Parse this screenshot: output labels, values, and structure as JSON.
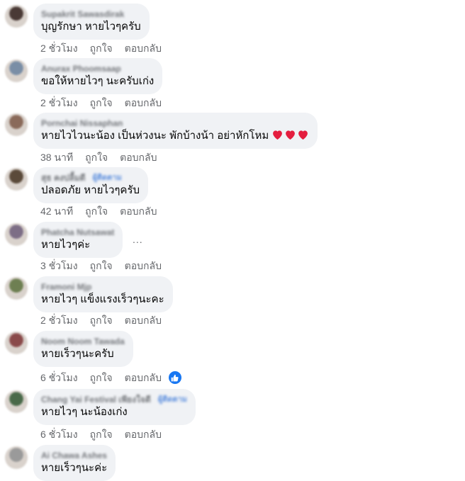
{
  "comments": [
    {
      "name": "Supakrit Sawasdirak",
      "text": "บุญรักษา หายไวๆครับ",
      "time": "2 ชั่วโมง",
      "like": "ถูกใจ",
      "reply": "ตอบกลับ",
      "avatar_color": "#4a3a36"
    },
    {
      "name": "Anurax Phoomsaap",
      "text": "ขอให้หายไวๆ นะครับเก่ง",
      "time": "2 ชั่วโมง",
      "like": "ถูกใจ",
      "reply": "ตอบกลับ",
      "avatar_color": "#7a8ea6"
    },
    {
      "name": "Pornchai Nissaphan",
      "text": "หายไวไวนะน้อง เป็นห่วงนะ พักบ้างน้า อย่าหักโหม",
      "time": "38 นาที",
      "like": "ถูกใจ",
      "reply": "ตอบกลับ",
      "avatar_color": "#8a6a5a",
      "emoji": "heart-icon"
    },
    {
      "name": "สุธ คงปลื้มดี",
      "badge": "ผู้ติดตาม",
      "text": "ปลอดภัย หายไวๆครับ",
      "time": "42 นาที",
      "like": "ถูกใจ",
      "reply": "ตอบกลับ",
      "avatar_color": "#5b4a3a"
    },
    {
      "name": "Phatcha Nutsawat",
      "text": "หายไวๆค่ะ",
      "time": "3 ชั่วโมง",
      "like": "ถูกใจ",
      "reply": "ตอบกลับ",
      "avatar_color": "#7d6e86",
      "more": "..."
    },
    {
      "name": "Framoni Mjp",
      "text": "หายไวๆ แข็งแรงเร็วๆนะคะ",
      "time": "2 ชั่วโมง",
      "like": "ถูกใจ",
      "reply": "ตอบกลับ",
      "avatar_color": "#6e7f52"
    },
    {
      "name": "Noom Noom Tawada",
      "text": "หายเร็วๆนะครับ",
      "time": "6 ชั่วโมง",
      "like": "ถูกใจ",
      "reply": "ตอบกลับ",
      "avatar_color": "#8a4a4a",
      "reaction": "like-icon"
    },
    {
      "name": "Chang Yai Festival เพียงใจดี",
      "badge": "ผู้ติดตาม",
      "text": "หายไวๆ นะน้องเก่ง",
      "time": "6 ชั่วโมง",
      "like": "ถูกใจ",
      "reply": "ตอบกลับ",
      "avatar_color": "#4a6a4a"
    },
    {
      "name": "Ai Chawa Ashes",
      "text": "หายเร็วๆนะค่ะ",
      "avatar_color": "#9a9a9a"
    }
  ],
  "colors": {
    "bubble": "#f0f2f5",
    "meta": "#65676b",
    "like_blue": "#1877f2",
    "heart": "#e41e3f"
  }
}
